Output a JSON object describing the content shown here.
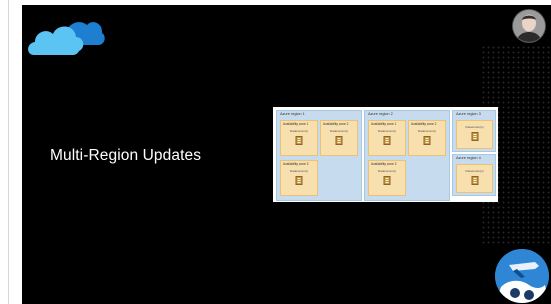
{
  "slide": {
    "title": "Multi-Region Updates"
  },
  "diagram": {
    "regions": [
      {
        "label": "Azure region 1"
      },
      {
        "label": "Azure region 2"
      },
      {
        "label": "Azure region 3"
      },
      {
        "label": "Azure region 4"
      }
    ],
    "zones": [
      {
        "label": "Availability zone 1",
        "dc": "Datacenter(s)"
      },
      {
        "label": "Availability zone 2",
        "dc": "Datacenter(s)"
      },
      {
        "label": "Availability zone 3",
        "dc": "Datacenter(s)"
      },
      {
        "label": "Availability zone 1",
        "dc": "Datacenter(s)"
      },
      {
        "label": "Availability zone 2",
        "dc": "Datacenter(s)"
      },
      {
        "label": "Availability zone 3",
        "dc": "Datacenter(s)"
      },
      {
        "label": "",
        "dc": "Datacenter(s)"
      },
      {
        "label": "",
        "dc": "Datacenter(s)"
      }
    ]
  },
  "colors": {
    "background": "#000000",
    "region_fill": "#c6dcee",
    "zone_fill": "#f7dfae",
    "cloud_light": "#5cc4f2",
    "cloud_dark": "#1e7fd1"
  }
}
